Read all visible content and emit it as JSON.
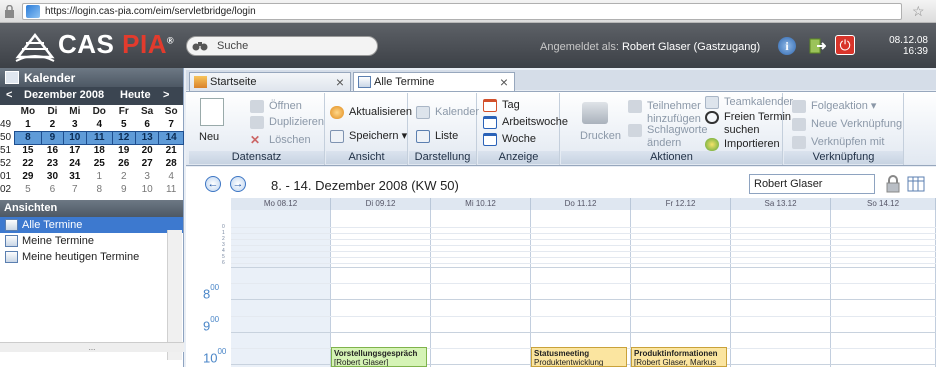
{
  "browser": {
    "url": "https://login.cas-pia.com/eim/servletbridge/login"
  },
  "app": {
    "brand_a": "CAS",
    "brand_b": "PIA",
    "reg": "®"
  },
  "header": {
    "search_placeholder": "Suche",
    "logged_prefix": "Angemeldet als:",
    "logged_user": "Robert Glaser (Gastzugang)",
    "date": "08.12.08",
    "time": "16:39"
  },
  "left": {
    "panel_title": "Kalender",
    "month": "Dezember 2008",
    "today": "Heute",
    "weekdays": [
      "Mo",
      "Di",
      "Mi",
      "Do",
      "Fr",
      "Sa",
      "So"
    ],
    "weeks": [
      {
        "wk": "49",
        "days": [
          "1",
          "2",
          "3",
          "4",
          "5",
          "6",
          "7"
        ]
      },
      {
        "wk": "50",
        "days": [
          "8",
          "9",
          "10",
          "11",
          "12",
          "13",
          "14"
        ]
      },
      {
        "wk": "51",
        "days": [
          "15",
          "16",
          "17",
          "18",
          "19",
          "20",
          "21"
        ]
      },
      {
        "wk": "52",
        "days": [
          "22",
          "23",
          "24",
          "25",
          "26",
          "27",
          "28"
        ]
      },
      {
        "wk": "01",
        "days": [
          "29",
          "30",
          "31",
          "1",
          "2",
          "3",
          "4"
        ]
      },
      {
        "wk": "02",
        "days": [
          "5",
          "6",
          "7",
          "8",
          "9",
          "10",
          "11"
        ]
      }
    ],
    "views_title": "Ansichten",
    "views": [
      "Alle Termine",
      "Meine Termine",
      "Meine heutigen Termine"
    ],
    "scroll_more": "..."
  },
  "tabs": [
    {
      "label": "Startseite"
    },
    {
      "label": "Alle Termine"
    }
  ],
  "ribbon": {
    "groups": {
      "datensatz": "Datensatz",
      "ansicht": "Ansicht",
      "darstellung": "Darstellung",
      "anzeige": "Anzeige",
      "aktionen": "Aktionen",
      "verknuepfung": "Verknüpfung"
    },
    "neu": "Neu",
    "oeffnen": "Öffnen",
    "duplizieren": "Duplizieren",
    "loeschen": "Löschen",
    "aktualisieren": "Aktualisieren",
    "speichern": "Speichern",
    "kalender": "Kalender",
    "liste": "Liste",
    "tag": "Tag",
    "arbeitswoche": "Arbeitswoche",
    "woche": "Woche",
    "drucken": "Drucken",
    "teilnehmer1": "Teilnehmer",
    "teilnehmer2": "hinzufügen",
    "schlagworte1": "Schlagworte",
    "schlagworte2": "ändern",
    "teamkalender": "Teamkalender",
    "freier1": "Freien Termin",
    "freier2": "suchen",
    "importieren": "Importieren",
    "folgeaktion": "Folgeaktion",
    "neue_verkn": "Neue Verknüpfung",
    "verkn_mit": "Verknüpfen mit"
  },
  "calendar": {
    "title": "8. - 14. Dezember 2008 (KW 50)",
    "person": "Robert Glaser",
    "days": [
      "Mo 08.12",
      "Di 09.12",
      "Mi 10.12",
      "Do 11.12",
      "Fr 12.12",
      "Sa 13.12",
      "So 14.12"
    ],
    "hours": [
      "8",
      "9",
      "10"
    ],
    "hour_sup": "00",
    "minor_hours": [
      "0",
      "1",
      "2",
      "3",
      "4",
      "5",
      "6"
    ],
    "appointments": [
      {
        "title": "Vorstellungsgespräch",
        "sub": "[Robert Glaser]"
      },
      {
        "title": "Statusmeeting",
        "sub": "Produktentwicklung"
      },
      {
        "title": "Produktinformationen",
        "sub": "[Robert Glaser, Markus"
      }
    ]
  }
}
